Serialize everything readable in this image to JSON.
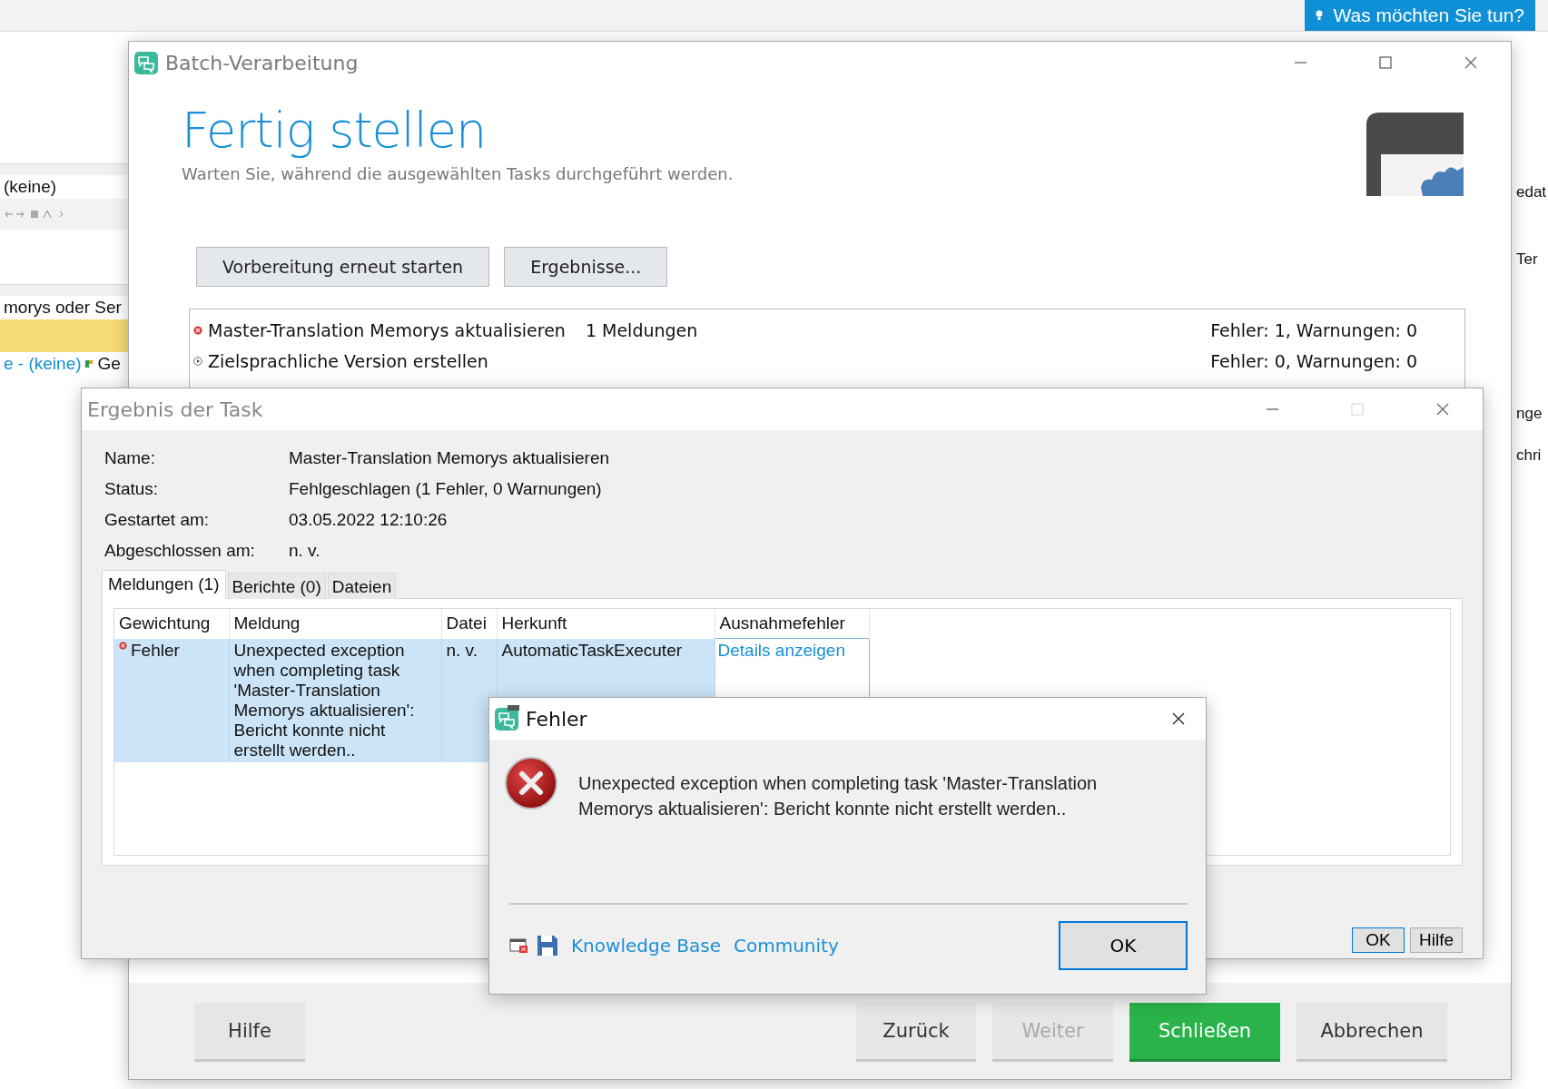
{
  "background_app": {
    "assistant_button": "Was möchten Sie tun?",
    "left_texts": [
      {
        "text": "(keine)",
        "kind": "field"
      },
      {
        "text": "morys oder Ser",
        "kind": "heading"
      },
      {
        "text": "e - (keine)",
        "kind": "link"
      },
      {
        "text": "Ge",
        "kind": "tab"
      }
    ],
    "right_texts": [
      "edat",
      "Ter",
      "nge",
      "chri"
    ]
  },
  "batch_window": {
    "title": "Batch-Verarbeitung",
    "heading": "Fertig stellen",
    "subtitle": "Warten Sie, während die ausgewählten Tasks durchgeführt werden.",
    "buttons": [
      "Vorbereitung erneut starten",
      "Ergebnisse..."
    ],
    "tasks": [
      {
        "name": "Master-Translation Memorys aktualisieren",
        "messages": "1 Meldungen",
        "summary": "Fehler: 1, Warnungen: 0",
        "error": true
      },
      {
        "name": "Zielsprachliche Version erstellen",
        "summary": "Fehler: 0, Warnungen: 0",
        "error": false
      }
    ],
    "footer_buttons": [
      {
        "label": "Hilfe",
        "kind": "secondary",
        "disabled": false
      },
      {
        "label": "Zurück",
        "kind": "secondary",
        "disabled": false
      },
      {
        "label": "Weiter",
        "kind": "secondary",
        "disabled": true
      },
      {
        "label": "Schließen",
        "kind": "primary",
        "disabled": false
      },
      {
        "label": "Abbrechen",
        "kind": "secondary",
        "disabled": false
      }
    ]
  },
  "result_window": {
    "title": "Ergebnis der Task",
    "fields": [
      {
        "label": "Name:",
        "value": "Master-Translation Memorys aktualisieren"
      },
      {
        "label": "Status:",
        "value": "Fehlgeschlagen (1 Fehler, 0 Warnungen)"
      },
      {
        "label": "Gestartet am:",
        "value": "03.05.2022 12:10:26"
      },
      {
        "label": "Abgeschlossen am:",
        "value": "n. v."
      }
    ],
    "tabs": [
      {
        "label": "Meldungen (1)",
        "selected": true
      },
      {
        "label": "Berichte (0)",
        "selected": false
      },
      {
        "label": "Dateien",
        "selected": false
      }
    ],
    "table": {
      "columns": [
        "Gewichtung",
        "Meldung",
        "Datei",
        "Herkunft",
        "Ausnahmefehler"
      ],
      "rows": [
        {
          "severity": "Fehler",
          "message": "Unexpected exception when completing task 'Master-Translation Memorys aktualisieren': Bericht konnte nicht erstellt werden..",
          "file": "n. v.",
          "origin": "AutomaticTaskExecuter",
          "exception_link": "Details anzeigen",
          "selected": true
        }
      ]
    },
    "buttons": [
      "OK",
      "Hilfe"
    ]
  },
  "error_dialog": {
    "title": "Fehler",
    "message": "Unexpected exception when completing task 'Master-Translation Memorys aktualisieren': Bericht konnte nicht erstellt werden..",
    "links": [
      "Knowledge Base",
      "Community"
    ],
    "button": "OK"
  }
}
